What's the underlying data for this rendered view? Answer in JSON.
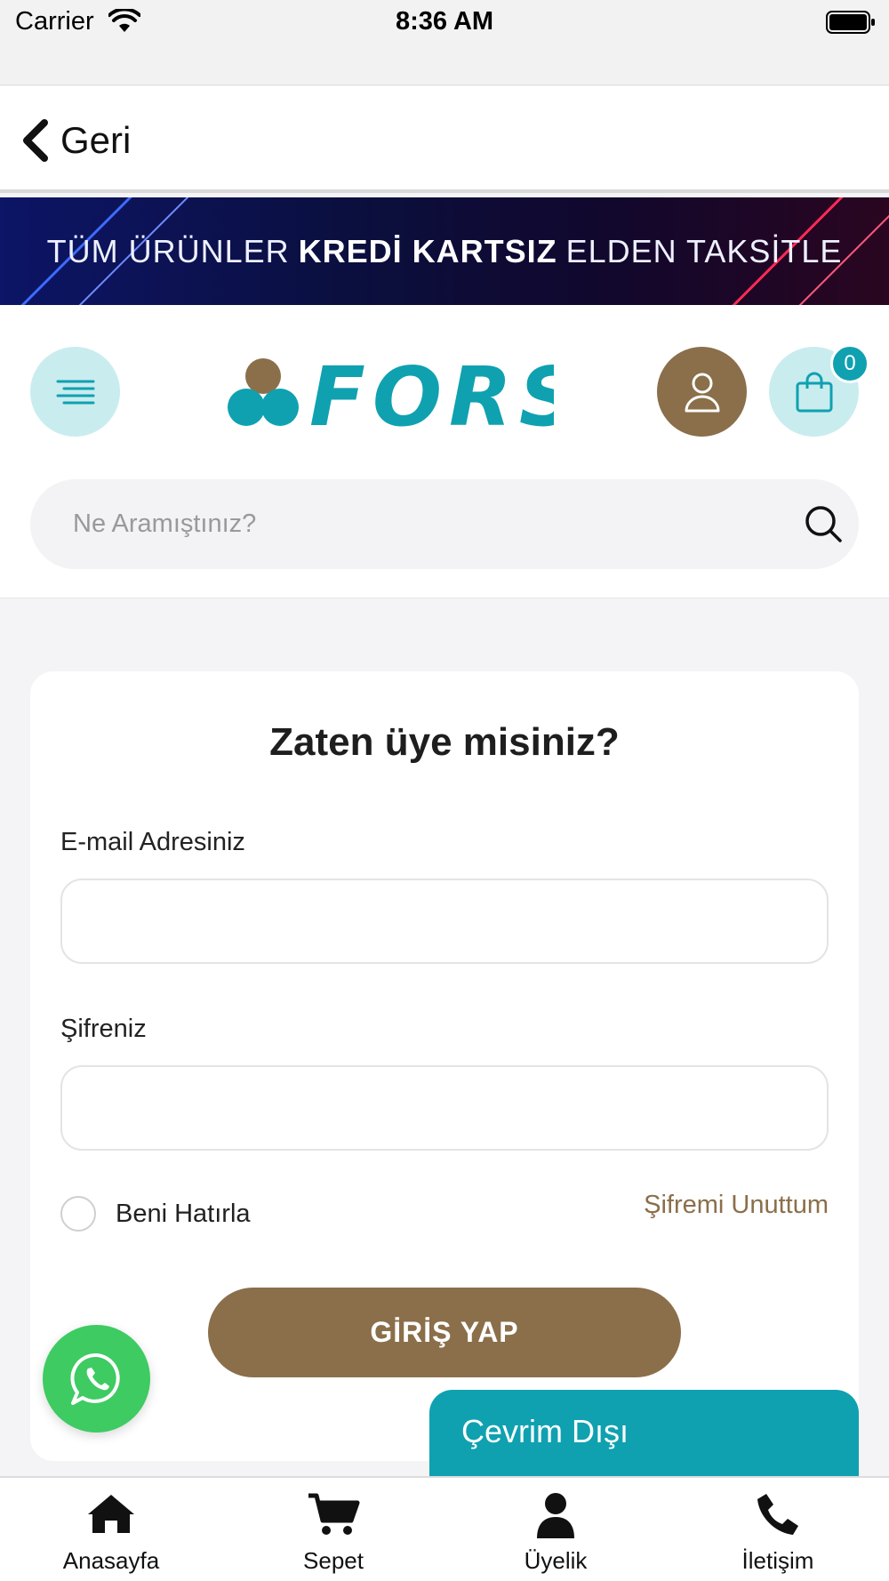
{
  "status_bar": {
    "carrier": "Carrier",
    "time": "8:36 AM"
  },
  "nav": {
    "back_label": "Geri"
  },
  "banner": {
    "text_before": "TÜM ÜRÜNLER",
    "text_bold": "KREDİ KARTSIZ",
    "text_after": "ELDEN TAKSİTLE"
  },
  "header": {
    "logo_text": "FORS",
    "cart_count": "0",
    "search_placeholder": "Ne Aramıştınız?"
  },
  "login": {
    "title": "Zaten üye misiniz?",
    "email_label": "E-mail Adresiniz",
    "email_value": "",
    "password_label": "Şifreniz",
    "password_value": "",
    "remember_label": "Beni Hatırla",
    "forgot_label": "Şifremi Unuttum",
    "submit_label": "GİRİŞ YAP"
  },
  "chat": {
    "offline_label": "Çevrim Dışı"
  },
  "tabbar": {
    "items": [
      {
        "label": "Anasayfa",
        "icon": "home-icon"
      },
      {
        "label": "Sepet",
        "icon": "cart-icon"
      },
      {
        "label": "Üyelik",
        "icon": "user-icon"
      },
      {
        "label": "İletişim",
        "icon": "phone-icon"
      }
    ]
  },
  "colors": {
    "teal": "#0fa1b0",
    "teal_light": "#c9ecef",
    "brown": "#8a6f4a",
    "whatsapp": "#3ecb62"
  }
}
